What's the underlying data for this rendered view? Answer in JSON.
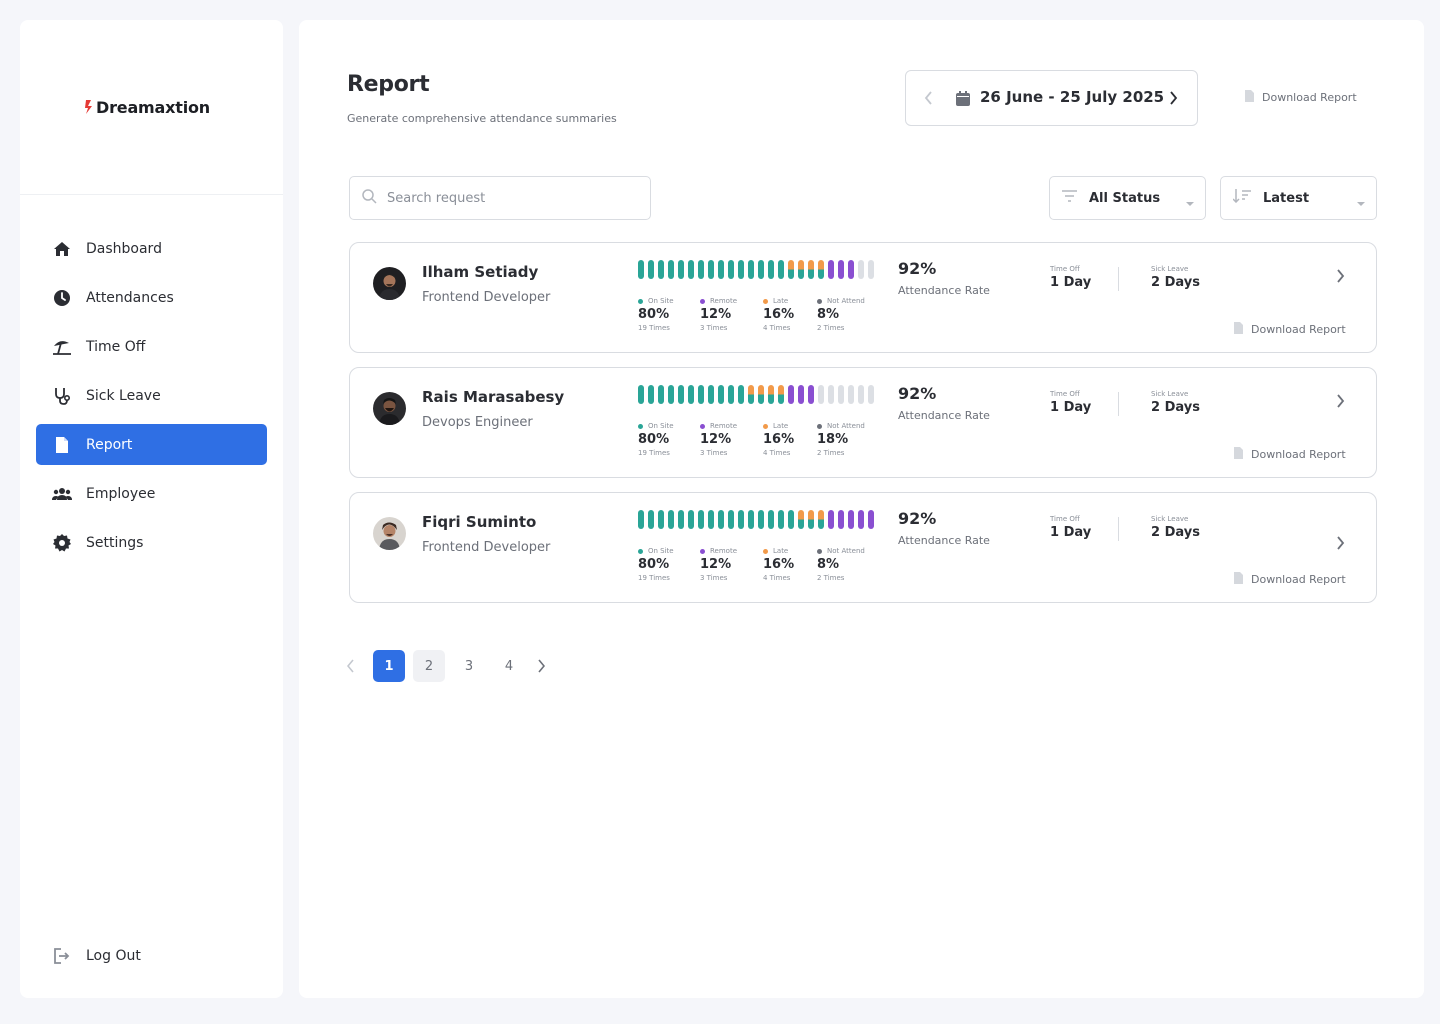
{
  "app": {
    "brand": "Dreamaxtion"
  },
  "sidebar": {
    "items": [
      {
        "label": "Dashboard",
        "icon": "home-icon"
      },
      {
        "label": "Attendances",
        "icon": "clock-icon"
      },
      {
        "label": "Time Off",
        "icon": "beach-umbrella-icon"
      },
      {
        "label": "Sick Leave",
        "icon": "stethoscope-icon"
      },
      {
        "label": "Report",
        "icon": "document-icon",
        "active": true
      },
      {
        "label": "Employee",
        "icon": "users-icon"
      },
      {
        "label": "Settings",
        "icon": "gear-icon"
      }
    ],
    "logout": "Log Out"
  },
  "header": {
    "title": "Report",
    "subtitle": "Generate comprehensive attendance summaries",
    "date_range": "26 June - 25 July 2025",
    "download_label": "Download Report"
  },
  "filters": {
    "search_placeholder": "Search request",
    "status": "All Status",
    "sort": "Latest"
  },
  "colors": {
    "accent": "#2f6fe4",
    "on_site": "#2aa597",
    "remote": "#8a4fd1",
    "late": "#f29a4a",
    "not_attend": "#dcdfe4"
  },
  "labels": {
    "on_site": "On Site",
    "remote": "Remote",
    "late": "Late",
    "not_attend": "Not Attend",
    "attendance_rate": "Attendance Rate",
    "time_off": "Time Off",
    "sick_leave": "Sick Leave",
    "download": "Download Report"
  },
  "employees": [
    {
      "name": "Ilham Setiady",
      "role": "Frontend Developer",
      "bars": [
        "o",
        "o",
        "o",
        "o",
        "o",
        "o",
        "o",
        "o",
        "o",
        "o",
        "o",
        "o",
        "o",
        "o",
        "o",
        "lo",
        "lo",
        "lo",
        "lo",
        "r",
        "r",
        "r",
        "n",
        "n"
      ],
      "on_site": {
        "pct": "80%",
        "times": "19 Times"
      },
      "remote": {
        "pct": "12%",
        "times": "3 Times"
      },
      "late": {
        "pct": "16%",
        "times": "4 Times"
      },
      "not_attend": {
        "pct": "8%",
        "times": "2 Times"
      },
      "rate": "92%",
      "time_off": "1 Day",
      "sick_leave": "2 Days"
    },
    {
      "name": "Rais Marasabesy",
      "role": "Devops Engineer",
      "bars": [
        "o",
        "o",
        "o",
        "o",
        "o",
        "o",
        "o",
        "o",
        "o",
        "o",
        "o",
        "lo",
        "lo",
        "lo",
        "lo",
        "r",
        "r",
        "r",
        "n",
        "n",
        "n",
        "n",
        "n",
        "n"
      ],
      "on_site": {
        "pct": "80%",
        "times": "19 Times"
      },
      "remote": {
        "pct": "12%",
        "times": "3 Times"
      },
      "late": {
        "pct": "16%",
        "times": "4 Times"
      },
      "not_attend": {
        "pct": "18%",
        "times": "2 Times"
      },
      "rate": "92%",
      "time_off": "1 Day",
      "sick_leave": "2 Days"
    },
    {
      "name": "Fiqri Suminto",
      "role": "Frontend Developer",
      "bars": [
        "o",
        "o",
        "o",
        "o",
        "o",
        "o",
        "o",
        "o",
        "o",
        "o",
        "o",
        "o",
        "o",
        "o",
        "o",
        "o",
        "lo",
        "lo",
        "lo",
        "r",
        "r",
        "r",
        "r",
        "r"
      ],
      "on_site": {
        "pct": "80%",
        "times": "19 Times"
      },
      "remote": {
        "pct": "12%",
        "times": "3 Times"
      },
      "late": {
        "pct": "16%",
        "times": "4 Times"
      },
      "not_attend": {
        "pct": "8%",
        "times": "2 Times"
      },
      "rate": "92%",
      "time_off": "1 Day",
      "sick_leave": "2 Days"
    }
  ],
  "pagination": {
    "pages": [
      "1",
      "2",
      "3",
      "4"
    ],
    "current": "1"
  }
}
